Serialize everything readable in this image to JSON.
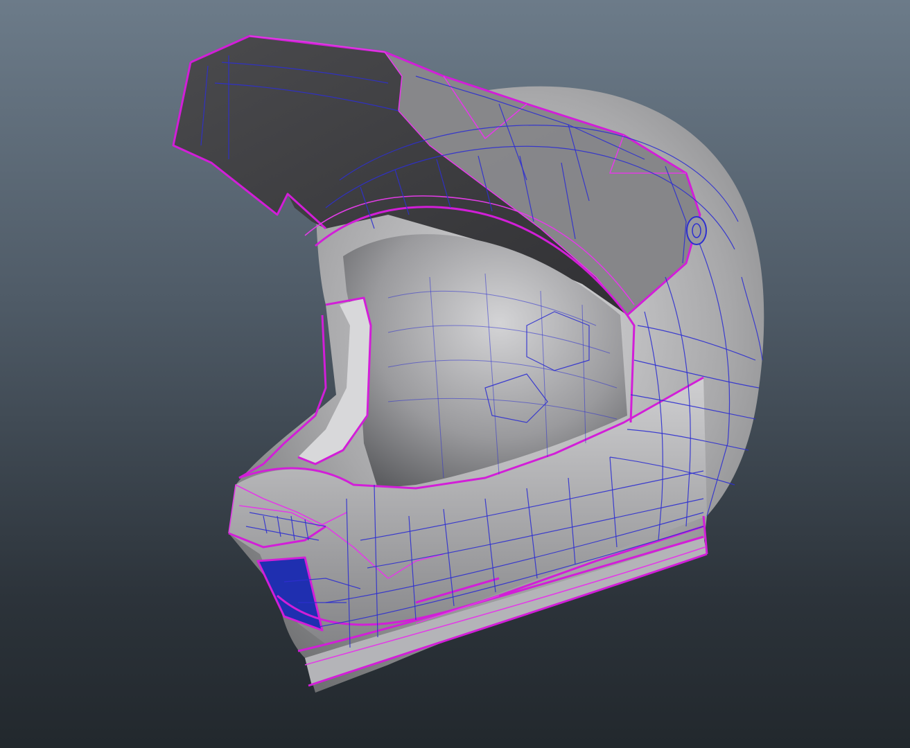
{
  "viewport": {
    "name": "3d-perspective-viewport",
    "background_top": "#6c7b89",
    "background_bottom": "#22282d"
  },
  "model": {
    "object": "motocross-helmet",
    "display_mode": "smooth-shaded-wireframe-on-shaded",
    "colors": {
      "shell": "#a9a9ab",
      "visor_underside": "#3f3f42",
      "selected_edges": "#d21ed8",
      "mesh_edges": "#2d2fd0",
      "vent_insert": "#1f2fb0"
    }
  }
}
